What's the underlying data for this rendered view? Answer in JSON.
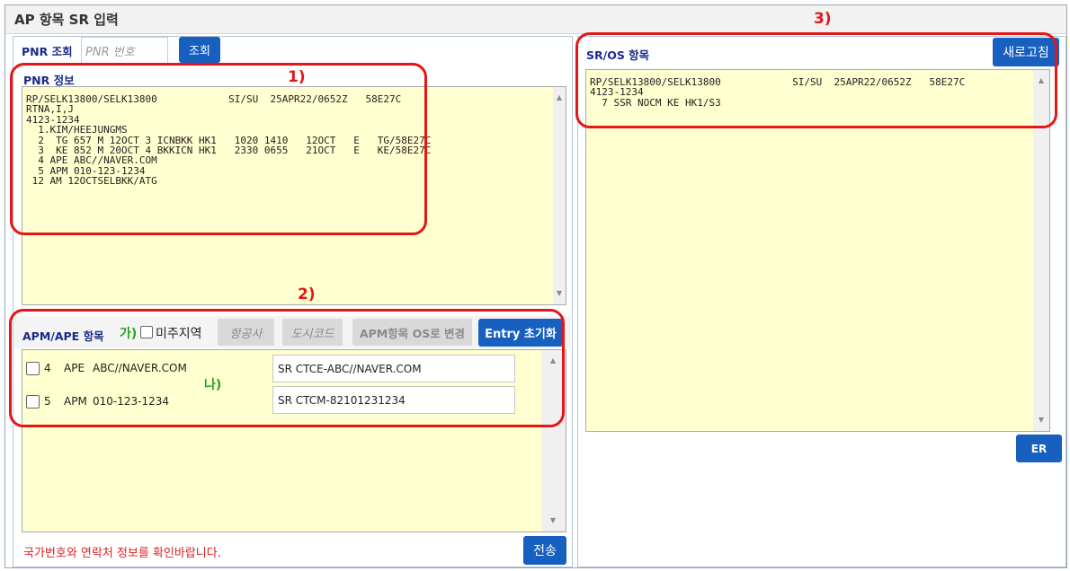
{
  "window": {
    "title": "AP 항목 SR 입력"
  },
  "pnr_lookup": {
    "label": "PNR 조회",
    "placeholder": "PNR 번호",
    "button": "조회"
  },
  "pnr_info": {
    "label": "PNR 정보",
    "lines": [
      "RP/SELK13800/SELK13800            SI/SU  25APR22/0652Z   58E27C",
      "RTNA,I,J",
      "4123-1234",
      "  1.KIM/HEEJUNGMS",
      "  2  TG 657 M 12OCT 3 ICNBKK HK1   1020 1410   12OCT   E   TG/58E27C",
      "  3  KE 852 M 20OCT 4 BKKICN HK1   2330 0655   21OCT   E   KE/58E27C",
      "  4 APE ABC//NAVER.COM",
      "  5 APM 010-123-1234",
      " 12 AM 12OCTSELBKK/ATG"
    ]
  },
  "apm_section": {
    "label": "APM/APE 항목",
    "us_region_label": "미주지역",
    "airline_placeholder": "항공사",
    "city_placeholder": "도시코드",
    "change_button": "APM항목 OS로 변경",
    "reset_button": "Entry 초기화",
    "rows": [
      {
        "num": "4",
        "type": "APE",
        "value": "ABC//NAVER.COM",
        "sr": "SR CTCE-ABC//NAVER.COM"
      },
      {
        "num": "5",
        "type": "APM",
        "value": "010-123-1234",
        "sr": "SR CTCM-82101231234"
      }
    ],
    "warning": "국가번호와 연락처 정보를 확인바랍니다.",
    "send_button": "전송"
  },
  "sros": {
    "label": "SR/OS 항목",
    "refresh_button": "새로고침",
    "lines": [
      "RP/SELK13800/SELK13800            SI/SU  25APR22/0652Z   58E27C",
      "4123-1234",
      "  7 SSR NOCM KE HK1/S3"
    ],
    "er_button": "ER"
  },
  "annotations": {
    "a1": "1)",
    "a2": "2)",
    "a3": "3)",
    "ga": "가)",
    "na": "나)"
  },
  "colors": {
    "accent": "#1760bf",
    "annotation_red": "#e41616",
    "annotation_green": "#1fa51f",
    "warning_red": "#e02020",
    "field_bg": "#ffffcf"
  }
}
